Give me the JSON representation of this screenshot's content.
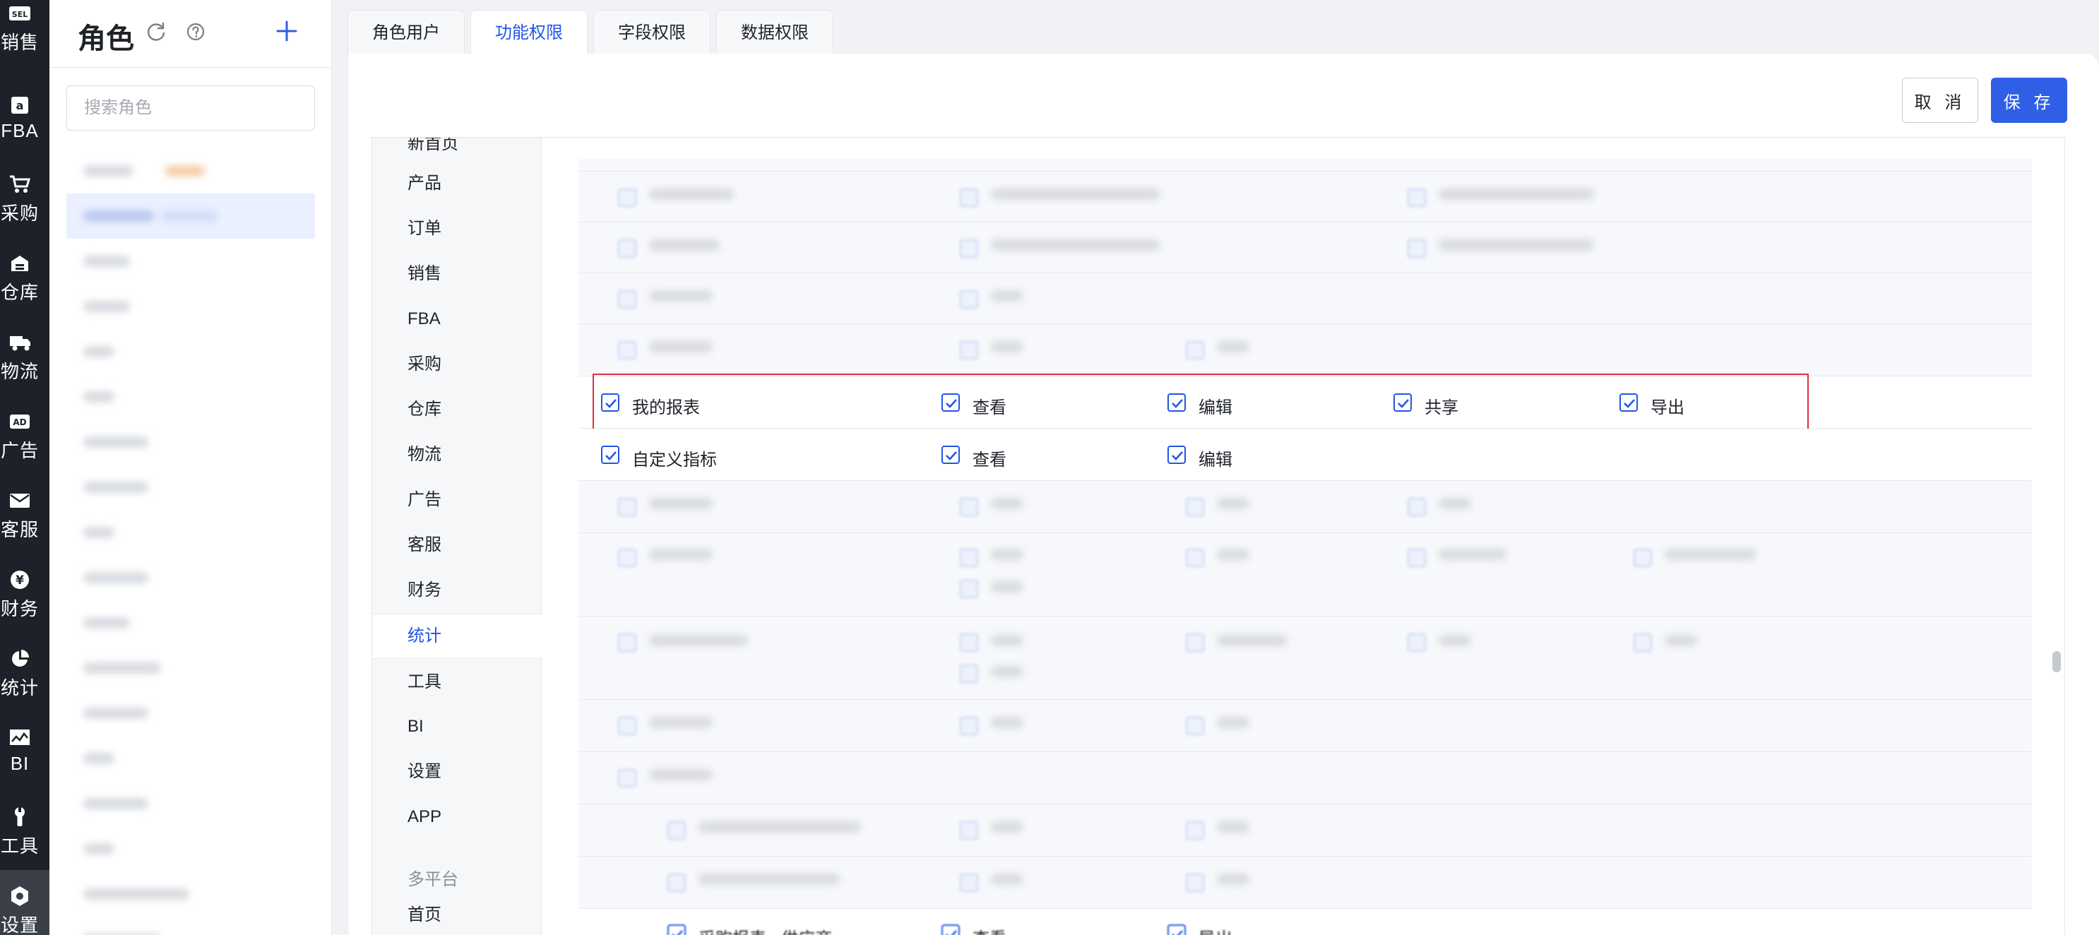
{
  "rail": {
    "items": [
      {
        "label": "销售",
        "icon": "sel-badge-icon",
        "badge": "SEL"
      },
      {
        "label": "FBA",
        "icon": "amazon-icon"
      },
      {
        "label": "采购",
        "icon": "cart-icon"
      },
      {
        "label": "仓库",
        "icon": "warehouse-icon"
      },
      {
        "label": "物流",
        "icon": "truck-icon"
      },
      {
        "label": "广告",
        "icon": "ad-badge-icon",
        "badge": "AD"
      },
      {
        "label": "客服",
        "icon": "mail-icon"
      },
      {
        "label": "财务",
        "icon": "yen-icon"
      },
      {
        "label": "统计",
        "icon": "pie-chart-icon"
      },
      {
        "label": "BI",
        "icon": "bi-chart-icon"
      },
      {
        "label": "工具",
        "icon": "wrench-icon"
      },
      {
        "label": "设置",
        "icon": "settings-hex-icon"
      }
    ],
    "active_index": 11
  },
  "role_panel": {
    "title": "角色",
    "search_placeholder": "搜索角色",
    "selected_index": 1
  },
  "tabs": [
    {
      "label": "角色用户",
      "active": false
    },
    {
      "label": "功能权限",
      "active": true
    },
    {
      "label": "字段权限",
      "active": false
    },
    {
      "label": "数据权限",
      "active": false
    }
  ],
  "actions": {
    "cancel_label": "取 消",
    "save_label": "保 存"
  },
  "modules": {
    "items": [
      "新首页",
      "产品",
      "订单",
      "销售",
      "FBA",
      "采购",
      "仓库",
      "物流",
      "广告",
      "客服",
      "财务",
      "统计",
      "工具",
      "BI",
      "设置",
      "APP"
    ],
    "active": "统计",
    "group_label": "多平台",
    "group_items": [
      "首页"
    ]
  },
  "permissions": {
    "visible_rows": [
      {
        "name": "我的报表",
        "checked": true,
        "highlighted": true,
        "actions": [
          {
            "label": "查看",
            "checked": true
          },
          {
            "label": "编辑",
            "checked": true
          },
          {
            "label": "共享",
            "checked": true
          },
          {
            "label": "导出",
            "checked": true
          }
        ]
      },
      {
        "name": "自定义指标",
        "checked": true,
        "highlighted": false,
        "actions": [
          {
            "label": "查看",
            "checked": true
          },
          {
            "label": "编辑",
            "checked": true
          }
        ]
      },
      {
        "name": "采购报表 - 供应商",
        "checked": true,
        "partial": true,
        "actions": [
          {
            "label": "查看",
            "checked": true
          },
          {
            "label": "导出",
            "checked": true
          }
        ]
      }
    ]
  },
  "colors": {
    "accent": "#2f5fe6",
    "highlight_border": "#e0303a",
    "rail_bg": "#1d2129"
  }
}
